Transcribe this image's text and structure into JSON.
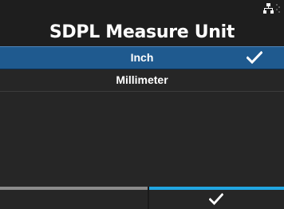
{
  "screen": {
    "title": "SDPL Measure Unit"
  },
  "status_bar": {
    "icons": [
      "network-icon",
      "signal-icon"
    ]
  },
  "options": [
    {
      "label": "Inch",
      "selected": true,
      "icon": "check-icon"
    },
    {
      "label": "Millimeter",
      "selected": false
    }
  ],
  "footer": {
    "left_button": {
      "icon": "none"
    },
    "right_button": {
      "icon": "check-icon"
    }
  },
  "colors": {
    "background": "#1e1e1e",
    "selected_row": "#1f5a8f",
    "left_button_bar": "#8b8b8b",
    "right_button_bar": "#21a6e2"
  }
}
